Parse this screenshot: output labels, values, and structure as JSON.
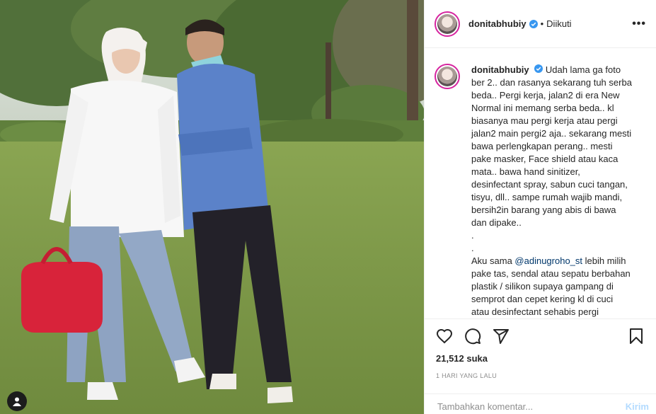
{
  "post": {
    "username": "donitabhubiy",
    "follow_separator": "•",
    "follow_status": "Diikuti",
    "more_glyph": "•••",
    "caption_lines": [
      "ber 2.. dan rasanya sekarang tuh serba",
      "beda.. Pergi kerja, jalan2 di era New",
      "Normal ini memang serba beda.. kl",
      "biasanya mau pergi kerja atau pergi",
      "jalan2 main pergi2 aja.. sekarang mesti",
      "bawa perlengkapan perang.. mesti",
      "pake masker, Face shield atau kaca",
      "mata.. bawa hand sinitizer,",
      "desinfectant spray, sabun cuci tangan,",
      "tisyu, dll.. sampe rumah wajib mandi,",
      "bersih2in barang yang abis di bawa",
      "dan dipake..",
      ".",
      "."
    ],
    "caption_first": "Udah lama ga foto",
    "caption2_prefix": "Aku sama ",
    "caption2_mention": "@adinugroho_st",
    "caption2_suffix": " lebih milih",
    "caption2_lines": [
      "pake tas, sendal atau sepatu berbahan",
      "plastik / silikon supaya gampang di",
      "semprot dan cepet kering kl di cuci",
      "atau desinfectant sehabis pergi"
    ],
    "likes": "21,512 suka",
    "timestamp": "1 HARI YANG LALU",
    "comment_placeholder": "Tambahkan komentar...",
    "post_button": "Kirim"
  },
  "icons": {
    "like": "heart-icon",
    "comment": "comment-icon",
    "share": "share-icon",
    "save": "bookmark-icon",
    "verified": "verified-badge-icon",
    "tag": "user-tag-icon"
  },
  "colors": {
    "verified": "#3897f0",
    "mention": "#00376b",
    "post_button_disabled": "#b3dbff",
    "avatar_ring": "#d6249f"
  }
}
